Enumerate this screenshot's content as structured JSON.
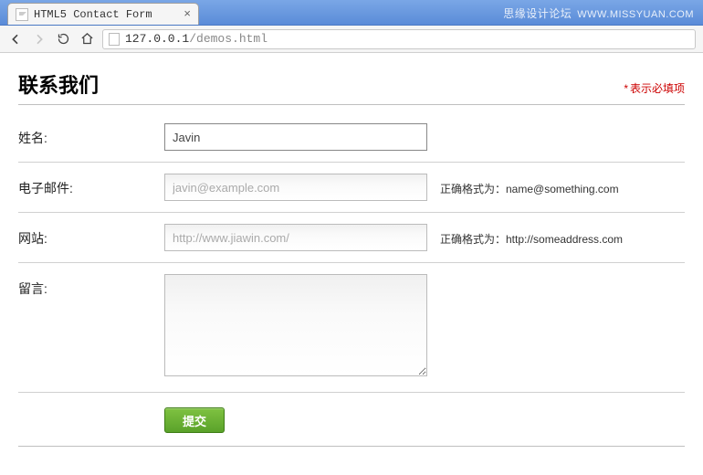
{
  "browser": {
    "tab_title": "HTML5 Contact Form",
    "url_host": "127.0.0.1",
    "url_path": "/demos.html"
  },
  "watermark": {
    "cn": "思缘设计论坛",
    "en": "WWW.MISSYUAN.COM"
  },
  "header": {
    "title": "联系我们",
    "required_star": "*",
    "required_text": "表示必填项"
  },
  "form": {
    "name": {
      "label": "姓名:",
      "value": "Javin"
    },
    "email": {
      "label": "电子邮件:",
      "placeholder": "javin@example.com",
      "hint": "正确格式为：name@something.com"
    },
    "website": {
      "label": "网站:",
      "placeholder": "http://www.jiawin.com/",
      "hint": "正确格式为：http://someaddress.com"
    },
    "message": {
      "label": "留言:"
    },
    "submit_label": "提交"
  }
}
